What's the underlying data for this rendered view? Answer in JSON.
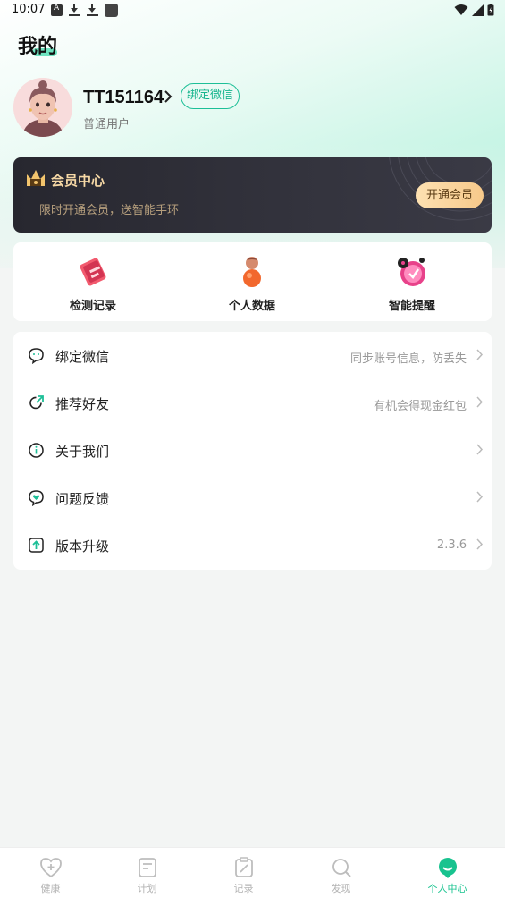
{
  "status_bar": {
    "time": "10:07"
  },
  "page": {
    "title": "我的"
  },
  "profile": {
    "username": "TT151164",
    "bind_wechat_badge": "绑定微信",
    "user_level": "普通用户"
  },
  "vip": {
    "title": "会员中心",
    "subtitle": "限时开通会员，送智能手环",
    "button_label": "开通会员"
  },
  "tools": [
    {
      "label": "检测记录",
      "icon": "record-card-icon"
    },
    {
      "label": "个人数据",
      "icon": "person-data-icon"
    },
    {
      "label": "智能提醒",
      "icon": "alarm-clock-icon"
    }
  ],
  "menu": [
    {
      "label": "绑定微信",
      "hint": "同步账号信息，防丢失",
      "icon": "wechat-icon"
    },
    {
      "label": "推荐好友",
      "hint": "有机会得现金红包",
      "icon": "share-icon"
    },
    {
      "label": "关于我们",
      "hint": "",
      "icon": "info-icon"
    },
    {
      "label": "问题反馈",
      "hint": "",
      "icon": "feedback-icon"
    },
    {
      "label": "版本升级",
      "hint": "2.3.6",
      "icon": "upgrade-icon"
    }
  ],
  "bottom_nav": [
    {
      "label": "健康",
      "icon": "heart-plus-icon",
      "active": false
    },
    {
      "label": "计划",
      "icon": "plan-doc-icon",
      "active": false
    },
    {
      "label": "记录",
      "icon": "edit-clipboard-icon",
      "active": false
    },
    {
      "label": "发现",
      "icon": "discover-search-icon",
      "active": false
    },
    {
      "label": "个人中心",
      "icon": "profile-smile-icon",
      "active": true
    }
  ],
  "colors": {
    "accent": "#18c38f",
    "vip_bg": "#2b2b33",
    "vip_gold": "#f7d9a6",
    "page_bg": "#f3f5f4"
  }
}
